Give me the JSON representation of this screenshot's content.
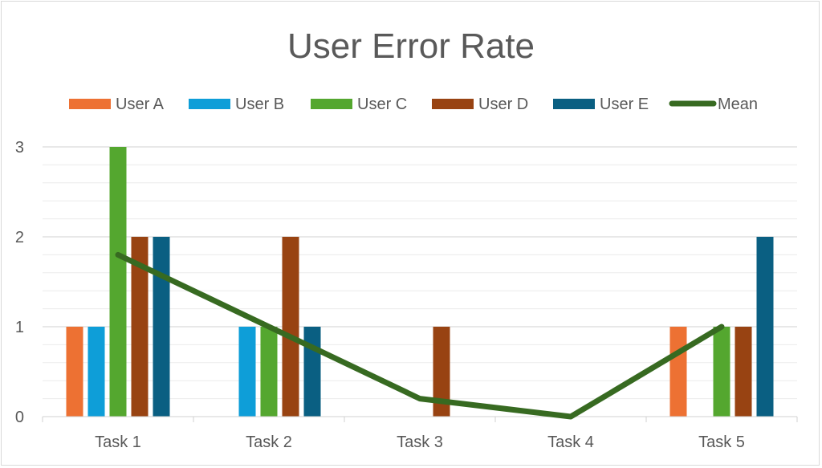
{
  "chart_data": {
    "type": "bar",
    "title": "User Error Rate",
    "xlabel": "",
    "ylabel": "",
    "categories": [
      "Task 1",
      "Task 2",
      "Task 3",
      "Task 4",
      "Task 5"
    ],
    "series": [
      {
        "name": "User A",
        "type": "bar",
        "color": "#ED7133",
        "values": [
          1,
          0,
          0,
          0,
          1
        ]
      },
      {
        "name": "User B",
        "type": "bar",
        "color": "#0E9ED8",
        "values": [
          1,
          1,
          0,
          0,
          0
        ]
      },
      {
        "name": "User C",
        "type": "bar",
        "color": "#54A72F",
        "values": [
          3,
          1,
          0,
          0,
          1
        ]
      },
      {
        "name": "User D",
        "type": "bar",
        "color": "#984312",
        "values": [
          2,
          2,
          1,
          0,
          1
        ]
      },
      {
        "name": "User E",
        "type": "bar",
        "color": "#0A5F82",
        "values": [
          2,
          1,
          0,
          0,
          2
        ]
      },
      {
        "name": "Mean",
        "type": "line",
        "color": "#376A21",
        "values": [
          1.8,
          1.0,
          0.2,
          0,
          1.0
        ]
      }
    ],
    "ylim": [
      0,
      3
    ],
    "yticks": [
      "0",
      "1",
      "2",
      "3"
    ],
    "grid": true,
    "minor_grid_step": 0.2,
    "legend": "top"
  }
}
